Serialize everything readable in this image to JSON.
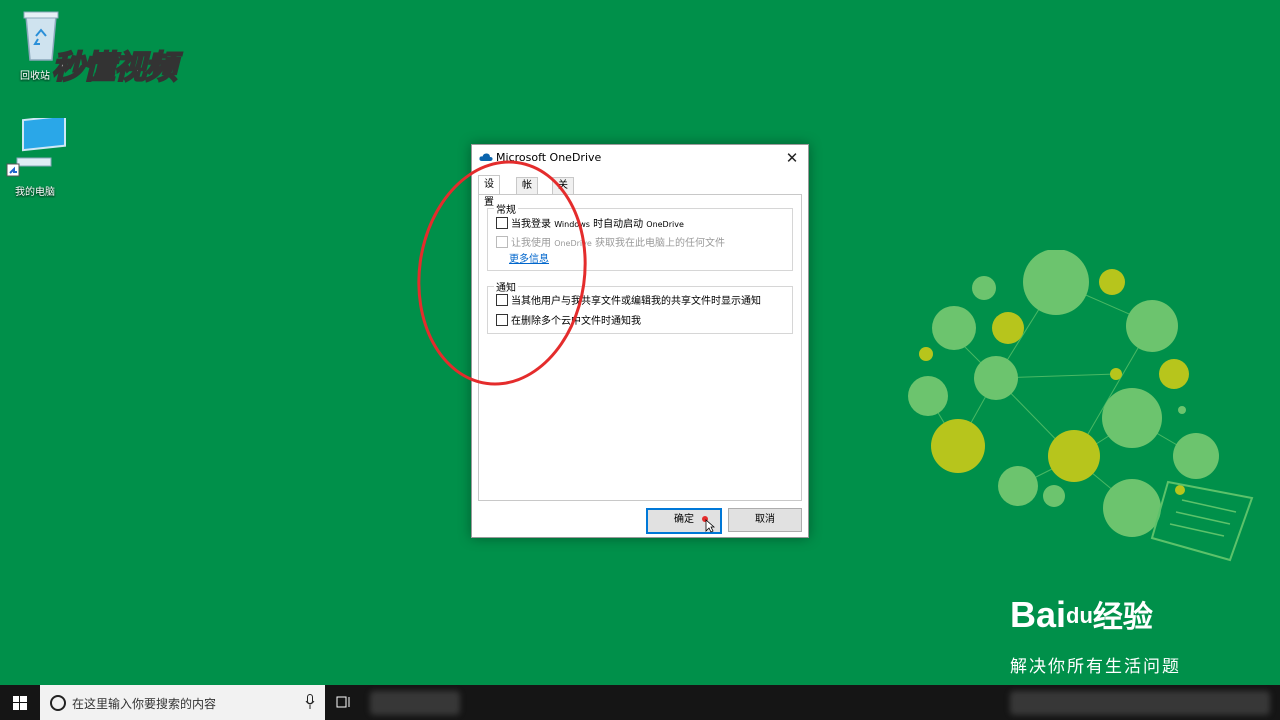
{
  "desktop": {
    "icons": [
      {
        "label": "回收站"
      },
      {
        "label": "我的电脑"
      }
    ],
    "watermark": "秒懂视频"
  },
  "dialog": {
    "title": "Microsoft OneDrive",
    "close_glyph": "✕",
    "tabs": [
      {
        "label": "设置",
        "active": true
      },
      {
        "label": "帐户",
        "active": false
      },
      {
        "label": "关于",
        "active": false
      }
    ],
    "general": {
      "legend": "常规",
      "auto_start": {
        "label_pre": "当我登录 ",
        "label_small": "Windows",
        "label_mid": " 时自动启动 ",
        "label_small2": "OneDrive",
        "checked": false
      },
      "fetch_files": {
        "label_pre": "让我使用 ",
        "label_small": "OneDrive",
        "label_post": " 获取我在此电脑上的任何文件",
        "checked": false,
        "disabled": true
      },
      "more_info": "更多信息"
    },
    "notify": {
      "legend": "通知",
      "shared_edit": {
        "label": "当其他用户与我共享文件或编辑我的共享文件时显示通知",
        "checked": false
      },
      "mass_delete": {
        "label": "在删除多个云中文件时通知我",
        "checked": false
      }
    },
    "buttons": {
      "ok": "确定",
      "cancel": "取消"
    }
  },
  "branding": {
    "baidu_logo_pre": "Bai",
    "baidu_logo_mid": "du",
    "baidu_logo_post": "经验",
    "slogan": "解决你所有生活问题"
  },
  "taskbar": {
    "search_placeholder": "在这里输入你要搜索的内容"
  },
  "colors": {
    "desktop_bg": "#00904a",
    "annotation": "#e42c2c",
    "link": "#0066cc",
    "accent": "#0078d7"
  }
}
